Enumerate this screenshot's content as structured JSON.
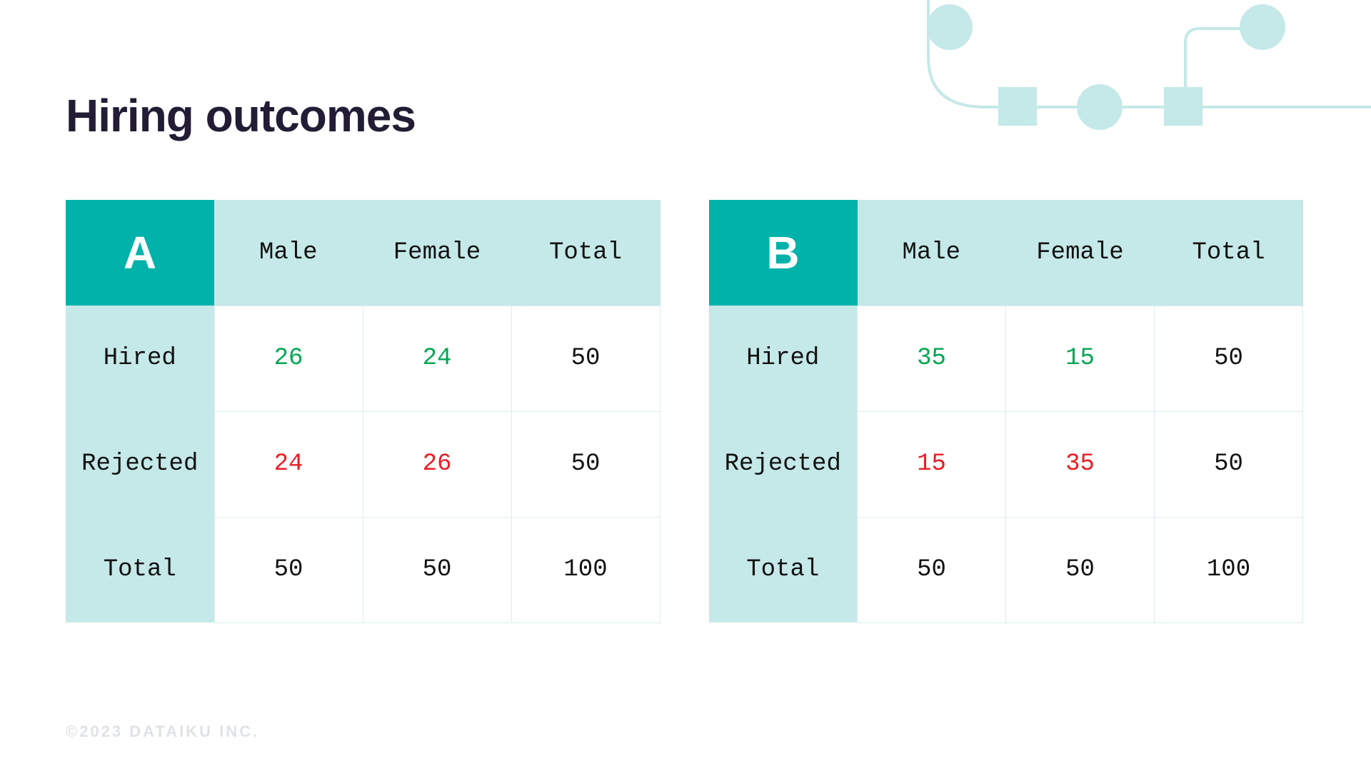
{
  "title": "Hiring outcomes",
  "footer": "©2023 DATAIKU INC.",
  "colors": {
    "accent": "#00b2a9",
    "light": "#c5e8e8",
    "green": "#00a651",
    "red": "#ec1c24"
  },
  "chart_data": [
    {
      "type": "table",
      "label": "A",
      "columns": [
        "Male",
        "Female",
        "Total"
      ],
      "rows": [
        "Hired",
        "Rejected",
        "Total"
      ],
      "values": [
        [
          26,
          24,
          50
        ],
        [
          24,
          26,
          50
        ],
        [
          50,
          50,
          100
        ]
      ],
      "cell_colors": [
        [
          "green",
          "green",
          ""
        ],
        [
          "red",
          "red",
          ""
        ],
        [
          "",
          "",
          ""
        ]
      ]
    },
    {
      "type": "table",
      "label": "B",
      "columns": [
        "Male",
        "Female",
        "Total"
      ],
      "rows": [
        "Hired",
        "Rejected",
        "Total"
      ],
      "values": [
        [
          35,
          15,
          50
        ],
        [
          15,
          35,
          50
        ],
        [
          50,
          50,
          100
        ]
      ],
      "cell_colors": [
        [
          "green",
          "green",
          ""
        ],
        [
          "red",
          "red",
          ""
        ],
        [
          "",
          "",
          ""
        ]
      ]
    }
  ]
}
